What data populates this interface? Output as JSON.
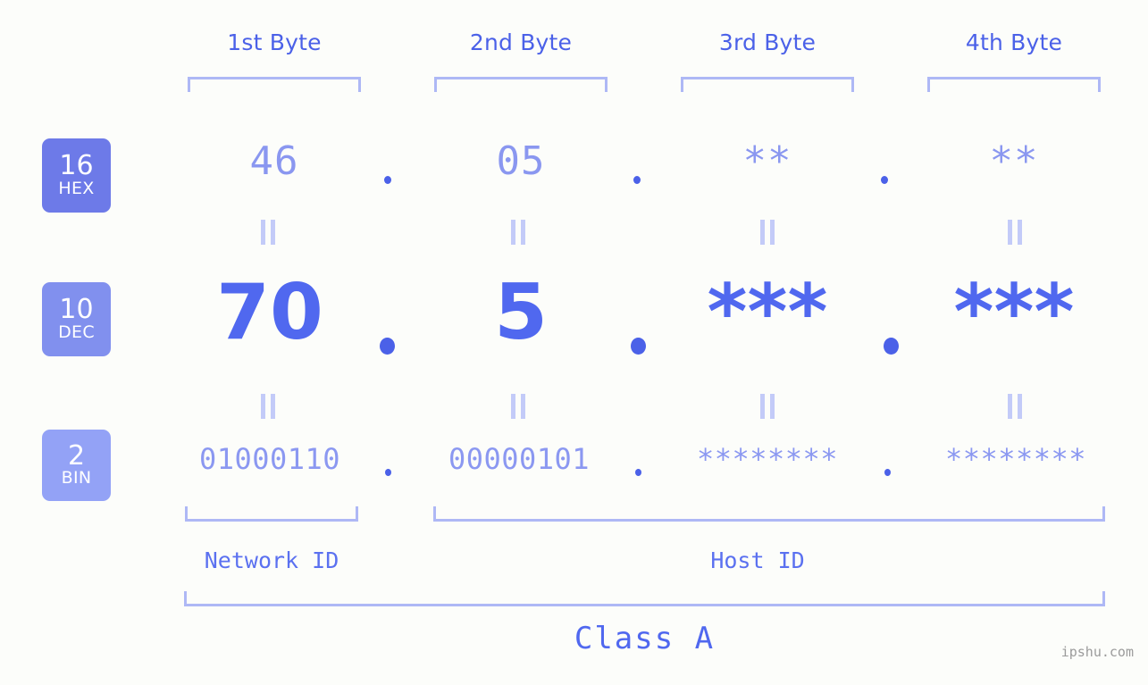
{
  "meta": {
    "watermark": "ipshu.com",
    "background_color": "#fcfdfa",
    "accent_color": "#4b61e8",
    "light_accent_color": "#aeb8f5"
  },
  "byte_headers": [
    {
      "label": "1st Byte"
    },
    {
      "label": "2nd Byte"
    },
    {
      "label": "3rd Byte"
    },
    {
      "label": "4th Byte"
    }
  ],
  "bases": [
    {
      "num": "16",
      "name": "HEX",
      "color": "#6d7ae8"
    },
    {
      "num": "10",
      "name": "DEC",
      "color": "#8190ee"
    },
    {
      "num": "2",
      "name": "BIN",
      "color": "#93a2f6"
    }
  ],
  "rows": {
    "hex": {
      "base_num": "16",
      "base_name": "HEX",
      "values": [
        "46",
        "05",
        "**",
        "**"
      ],
      "separator": "."
    },
    "dec": {
      "base_num": "10",
      "base_name": "DEC",
      "values": [
        "70",
        "5",
        "***",
        "***"
      ],
      "separator": "."
    },
    "bin": {
      "base_num": "2",
      "base_name": "BIN",
      "values": [
        "01000110",
        "00000101",
        "********",
        "********"
      ],
      "separator": "."
    }
  },
  "equals_marks": {
    "glyph": "=",
    "count_per_gap": 4,
    "gaps": 2
  },
  "id_sections": [
    {
      "label": "Network ID"
    },
    {
      "label": "Host ID"
    }
  ],
  "class_section": {
    "label": "Class A"
  }
}
